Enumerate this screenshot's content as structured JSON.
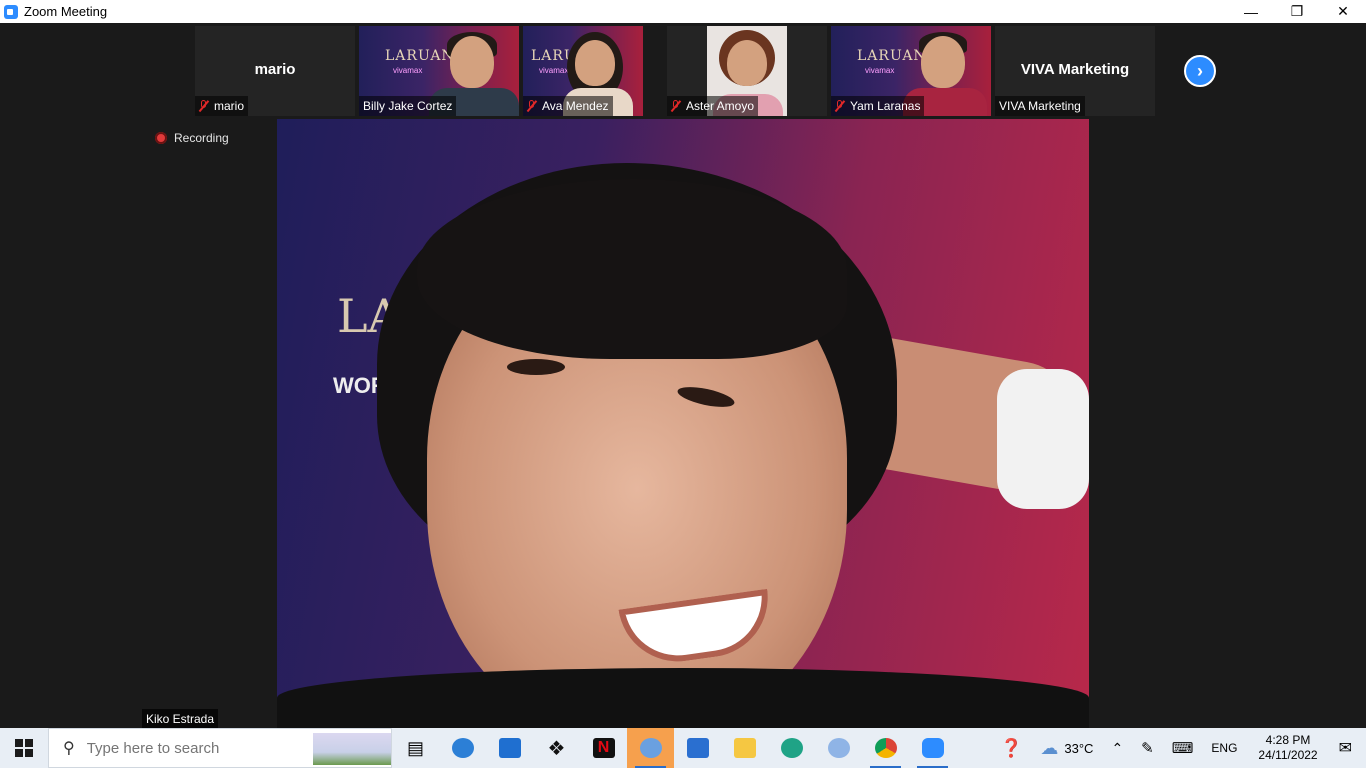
{
  "window": {
    "title": "Zoom Meeting"
  },
  "participants": [
    {
      "name": "mario",
      "display": "mario",
      "muted": true,
      "video": false
    },
    {
      "name": "Billy Jake Cortez",
      "muted": false,
      "video": true
    },
    {
      "name": "Ava Mendez",
      "muted": true,
      "video": true
    },
    {
      "name": "Aster Amoyo",
      "muted": true,
      "video": true
    },
    {
      "name": "Yam Laranas",
      "muted": true,
      "video": true
    },
    {
      "name": "VIVA Marketing",
      "display": "VIVA Marketing",
      "muted": false,
      "video": false
    }
  ],
  "poster": {
    "logo": "LARUAN",
    "brand": "vivamax"
  },
  "main": {
    "recording_label": "Recording",
    "speaker_name": "Kiko Estrada",
    "wall_text": "LA",
    "wall_sub": "WORLD"
  },
  "taskbar": {
    "search_placeholder": "Type here to search",
    "weather": "33°C",
    "language": "ENG",
    "time": "4:28 PM",
    "date": "24/11/2022"
  },
  "colors": {
    "accent": "#2d8cff",
    "muted": "#e02828",
    "recording": "#e03a3a"
  }
}
